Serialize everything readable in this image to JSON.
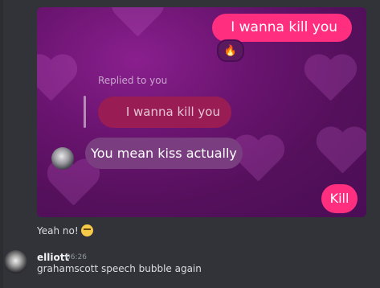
{
  "embed": {
    "messages": {
      "sent_top": "I wanna kill you",
      "reaction_emoji": "🔥",
      "replied_label": "Replied to you",
      "replied_quote": "I wanna kill you",
      "received": "You mean kiss actually",
      "sent_bottom": "Kill"
    }
  },
  "chat": {
    "message1_text": "Yeah no!",
    "message1_emoji": "unamused-face-emoji",
    "user": {
      "name": "elliott",
      "time": "06:26",
      "message": "grahamscott speech bubble again"
    }
  },
  "colors": {
    "background": "#313338",
    "pink_bubble": "#ff2e7e",
    "reply_bubble": "#9a1c55",
    "grey_bubble": "#7a3d7f"
  }
}
